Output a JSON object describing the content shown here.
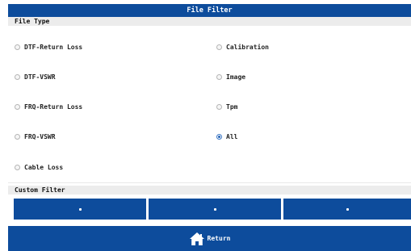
{
  "window": {
    "title": "File Filter"
  },
  "file_type": {
    "header": "File Type",
    "options": [
      {
        "label": "DTF-Return Loss",
        "checked": false
      },
      {
        "label": "Calibration",
        "checked": false
      },
      {
        "label": "DTF-VSWR",
        "checked": false
      },
      {
        "label": "Image",
        "checked": false
      },
      {
        "label": "FRQ-Return Loss",
        "checked": false
      },
      {
        "label": "Tpm",
        "checked": false
      },
      {
        "label": "FRQ-VSWR",
        "checked": false
      },
      {
        "label": "All",
        "checked": true
      },
      {
        "label": "Cable Loss",
        "checked": false
      }
    ]
  },
  "custom_filter": {
    "header": "Custom Filter",
    "slots": 3
  },
  "footer": {
    "return_label": "Return",
    "icon": "home-icon"
  },
  "colors": {
    "accent": "#0d4c9c",
    "radio_selected": "#1f5fb4",
    "header_bg": "#ececec"
  }
}
